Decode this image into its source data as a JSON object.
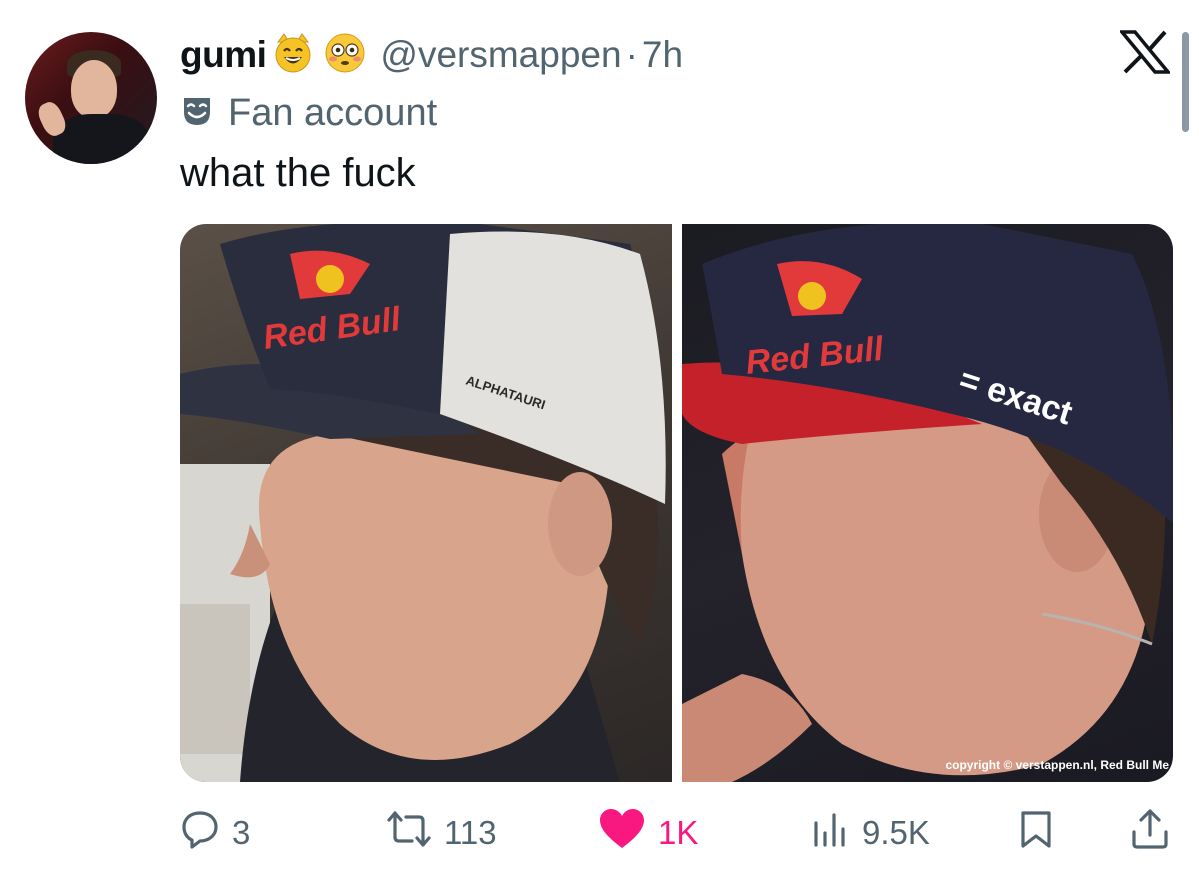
{
  "tweet": {
    "display_name": "gumi",
    "name_emojis": [
      "😸",
      "😳"
    ],
    "handle": "@versmappen",
    "separator": "·",
    "time": "7h",
    "label_icon": "mask-icon",
    "label": "Fan account",
    "text": "what the fuck"
  },
  "media": {
    "left": {
      "description": "AlphaTauri cap side profile photo",
      "cap_text_1": "Red Bull",
      "cap_text_2": "ALPHATAURI"
    },
    "right": {
      "description": "Red Bull cap side profile photo",
      "cap_text_1": "Red Bull",
      "cap_text_2": "= exact",
      "copyright": "copyright © verstappen.nl, Red Bull Me"
    }
  },
  "actions": {
    "replies": "3",
    "reposts": "113",
    "likes": "1K",
    "views": "9.5K"
  },
  "colors": {
    "like_accent": "#f91880",
    "secondary_text": "#536471",
    "primary_text": "#0f1419"
  }
}
